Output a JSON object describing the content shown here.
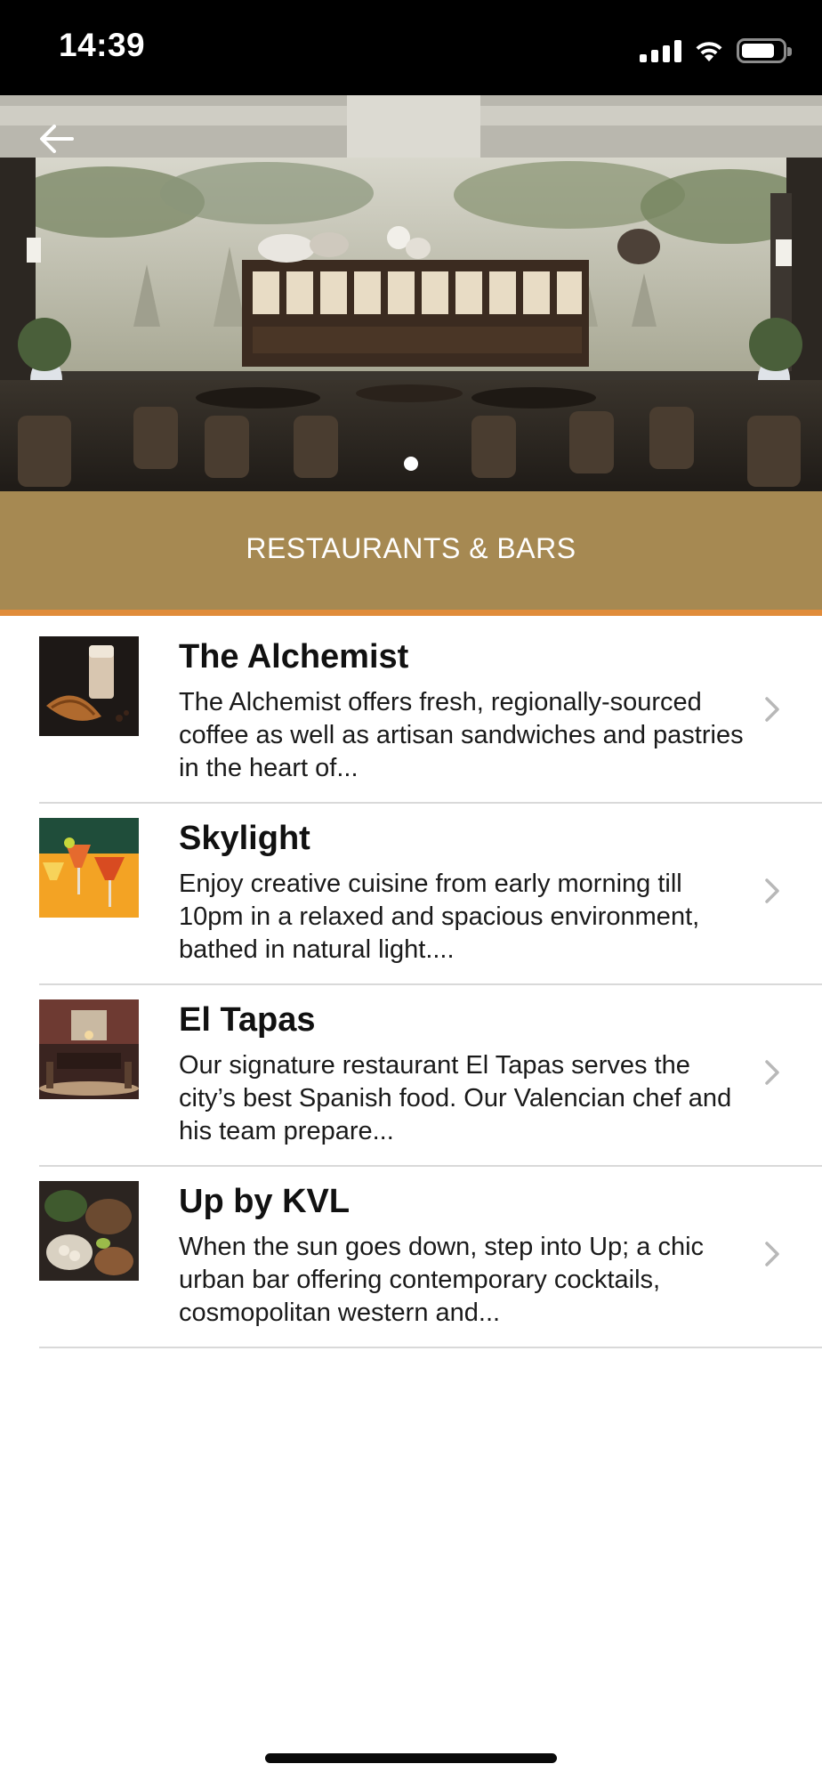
{
  "status_bar": {
    "time": "14:39"
  },
  "hero": {
    "carousel_index": 1,
    "carousel_count": 1
  },
  "section": {
    "title": "RESTAURANTS & BARS"
  },
  "venues": [
    {
      "name": "The Alchemist",
      "description": "The Alchemist offers fresh, regionally-sourced coffee as well as artisan sandwiches and pastries in the heart of..."
    },
    {
      "name": "Skylight",
      "description": "Enjoy creative cuisine from early morning till 10pm in a relaxed and spacious environment, bathed in natural light...."
    },
    {
      "name": "El Tapas",
      "description": "Our signature restaurant El Tapas serves the city’s best Spanish food. Our Valencian chef and his team prepare..."
    },
    {
      "name": "Up by KVL",
      "description": "When the sun goes down, step into Up; a chic urban bar offering contemporary cocktails, cosmopolitan western and..."
    }
  ],
  "colors": {
    "header_bg": "#a68952",
    "header_accent": "#e08c3a",
    "divider": "#d9d9d9"
  }
}
